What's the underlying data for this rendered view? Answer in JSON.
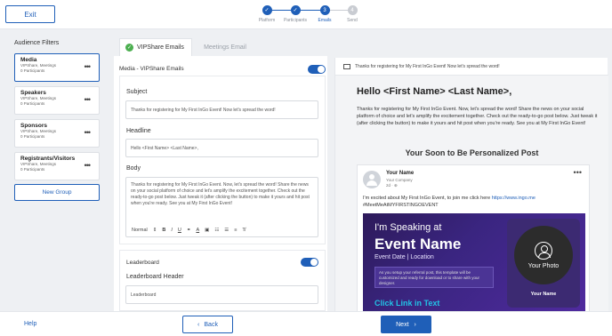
{
  "header": {
    "exit_label": "Exit",
    "steps": [
      {
        "label": "Platform",
        "num": "✓"
      },
      {
        "label": "Participants",
        "num": "✓"
      },
      {
        "label": "Emails",
        "num": "3"
      },
      {
        "label": "Send",
        "num": "4"
      }
    ]
  },
  "sidebar": {
    "title": "Audience Filters",
    "items": [
      {
        "name": "Media",
        "platform": "VIPShare, Meetings",
        "count": "0 Participants"
      },
      {
        "name": "Speakers",
        "platform": "VIPShare, Meetings",
        "count": "0 Participants"
      },
      {
        "name": "Sponsors",
        "platform": "VIPShare, Meetings",
        "count": "0 Participants"
      },
      {
        "name": "Registrants/Visitors",
        "platform": "VIPShare, Meetings",
        "count": "0 Participants"
      }
    ],
    "new_group_label": "New Group"
  },
  "tabs": [
    {
      "label": "VIPShare Emails"
    },
    {
      "label": "Meetings Email"
    }
  ],
  "editor": {
    "section_title": "Media - VIPShare Emails",
    "subject_label": "Subject",
    "subject_value": "Thanks for registering for My First InGo Event! Now let's spread the word!",
    "headline_label": "Headline",
    "headline_value": "Hello <First Name> <Last Name>,",
    "body_label": "Body",
    "body_value": "Thanks for registering for My First InGo Event. Now, let's spread the word! Share the news on your social platform of choice and let's amplify the excitement together. Check out the ready-to-go post below. Just tweak it (after clicking the button) to make it yours and hit post when you're ready. See you at My First InGo Event!",
    "toolbar_format": "Normal",
    "leaderboard_title": "Leaderboard",
    "leaderboard_header_label": "Leaderboard Header",
    "leaderboard_header_value": "Leaderboard"
  },
  "preview": {
    "subject": "Thanks for registering for My First InGo Event! Now let's spread the word!",
    "hello": "Hello <First Name> <Last Name>,",
    "body": "Thanks for registering for My First InGo Event. Now, let's spread the word! Share the news on your social platform of choice and let's amplify the excitement together. Check out the ready-to-go post below. Just tweak it (after clicking the button) to make it yours and hit post when you're ready. See you at My First InGo Event!",
    "soon_title": "Your Soon to Be Personalized Post",
    "post_name": "Your Name",
    "post_company": "Your Company",
    "post_time": "2d ·",
    "post_text": "I'm excited about My First InGo Event, to join me click here ",
    "post_link": "https://www.ingo.me",
    "post_hashtag": "#MeetMeAtMYFIRSTINGOEVENT",
    "banner_line1": "I'm Speaking at",
    "banner_line2": "Event Name",
    "banner_line3": "Event Date | Location",
    "banner_note": "As you setup your referral post, this template will be customized and ready for download or to share with your designer.",
    "banner_link": "Click Link in Text",
    "photo_label": "Your Photo",
    "photo_name": "Your Name"
  },
  "footer": {
    "help": "Help",
    "back": "Back",
    "next": "Next"
  }
}
